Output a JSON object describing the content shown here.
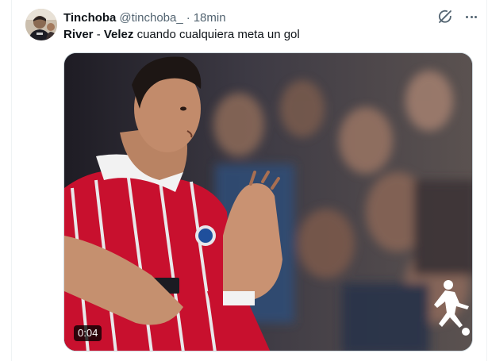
{
  "tweet": {
    "author": {
      "display_name": "Tinchoba",
      "handle": "@tinchoba_",
      "separator": "·",
      "time": "18min"
    },
    "text": {
      "part1_bold": "River",
      "part2": " - ",
      "part3_bold": "Velez",
      "part4": " cuando cualquiera meta un gol"
    },
    "media": {
      "type": "video",
      "duration": "0:04",
      "watermark_icon": "player-kicking-logo"
    },
    "icons": {
      "grok": "grok-icon",
      "more": "more-options-icon"
    }
  }
}
